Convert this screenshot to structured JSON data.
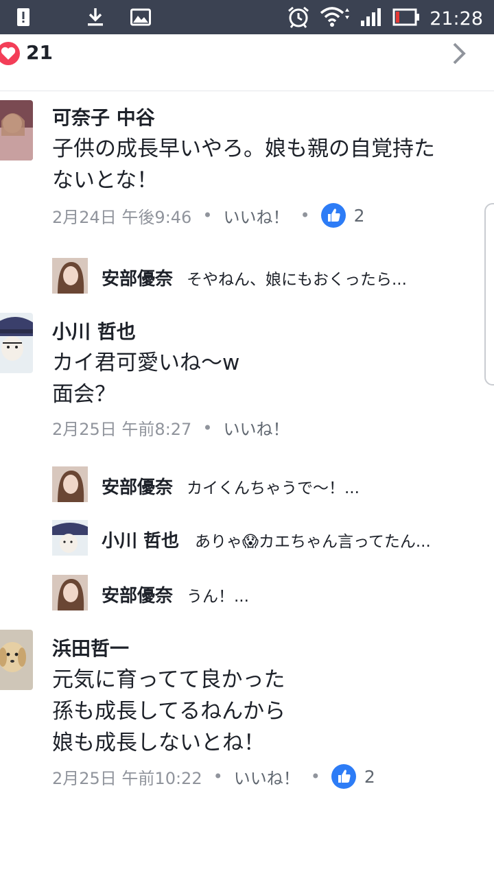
{
  "status_bar": {
    "time": "21:28",
    "left_icons": [
      "alert-icon",
      "download-icon",
      "gallery-icon"
    ],
    "right_icons": [
      "alarm-icon",
      "wifi-icon",
      "signal-icon",
      "battery-icon"
    ]
  },
  "reactions": {
    "count": "21",
    "icon": "heart-icon",
    "heart_color": "#f33e58"
  },
  "colors": {
    "like_blue": "#2d7cf6",
    "meta_gray": "#90949c",
    "status_bar": "#3b4252"
  },
  "comments": [
    {
      "name": "可奈子 中谷",
      "lines": [
        "子供の成長早いやろ。娘も親の自覚持た",
        "ないとな！"
      ],
      "time": "2月24日 午後9:46",
      "like_label": "いいね！",
      "likes": "2",
      "replies": [
        {
          "name": "安部優奈",
          "text": "そやねん、娘にもおくったら..."
        }
      ]
    },
    {
      "name": "小川 哲也",
      "lines": [
        "カイ君可愛いね〜w",
        "面会？"
      ],
      "time": "2月25日 午前8:27",
      "like_label": "いいね！",
      "replies": [
        {
          "name": "安部優奈",
          "text": "カイくんちゃうで〜！..."
        },
        {
          "name": "小川 哲也",
          "text": "ありゃ😱カエちゃん言ってたん..."
        },
        {
          "name": "安部優奈",
          "text": "うん！..."
        }
      ]
    },
    {
      "name": "浜田哲一",
      "lines": [
        "元気に育ってて良かった",
        "孫も成長してるねんから",
        "娘も成長しないとね！"
      ],
      "time": "2月25日 午前10:22",
      "like_label": "いいね！",
      "likes": "2"
    }
  ]
}
